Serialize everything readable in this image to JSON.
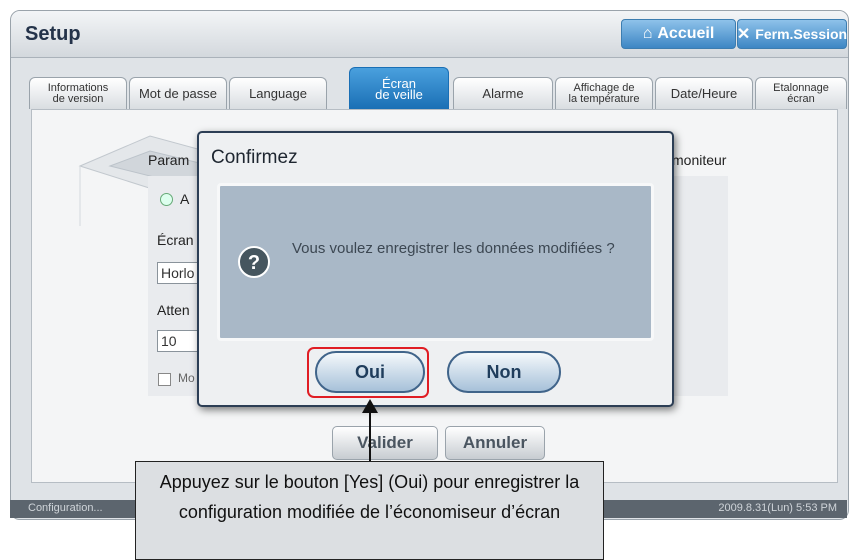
{
  "header": {
    "title": "Setup",
    "home_label": "Accueil",
    "logout_label": "Ferm.Session"
  },
  "tabs": [
    {
      "label": "Informations\nde version",
      "active": false
    },
    {
      "label": "Mot de passe",
      "active": false
    },
    {
      "label": "Language",
      "active": false
    },
    {
      "label": "Écran\nde veille",
      "active": true
    },
    {
      "label": "Alarme",
      "active": false
    },
    {
      "label": "Affichage de\nla température",
      "active": false
    },
    {
      "label": "Date/Heure",
      "active": false
    },
    {
      "label": "Etalonnage\nécran",
      "active": false
    }
  ],
  "background_panel": {
    "param_label": "Param",
    "monitor_label": "moniteur",
    "radio_label": "A",
    "screen_label": "Écran",
    "screen_value": "Horlo",
    "wait_label": "Atten",
    "wait_value": "10",
    "check_label": "Mo"
  },
  "footer_buttons": {
    "validate_label": "Valider",
    "cancel_label": "Annuler"
  },
  "statusbar": {
    "left_text": "Configuration...",
    "right_text": "2009.8.31(Lun) 5:53 PM"
  },
  "dialog": {
    "title": "Confirmez",
    "message": "Vous voulez enregistrer les données modifiées ?",
    "yes_label": "Oui",
    "no_label": "Non"
  },
  "callout": {
    "text": "Appuyez sur le bouton [Yes] (Oui) pour enregistrer la configuration modifiée de l’économiseur d’écran"
  },
  "colors": {
    "accent": "#2a7fc2",
    "highlight": "#e01d24"
  }
}
